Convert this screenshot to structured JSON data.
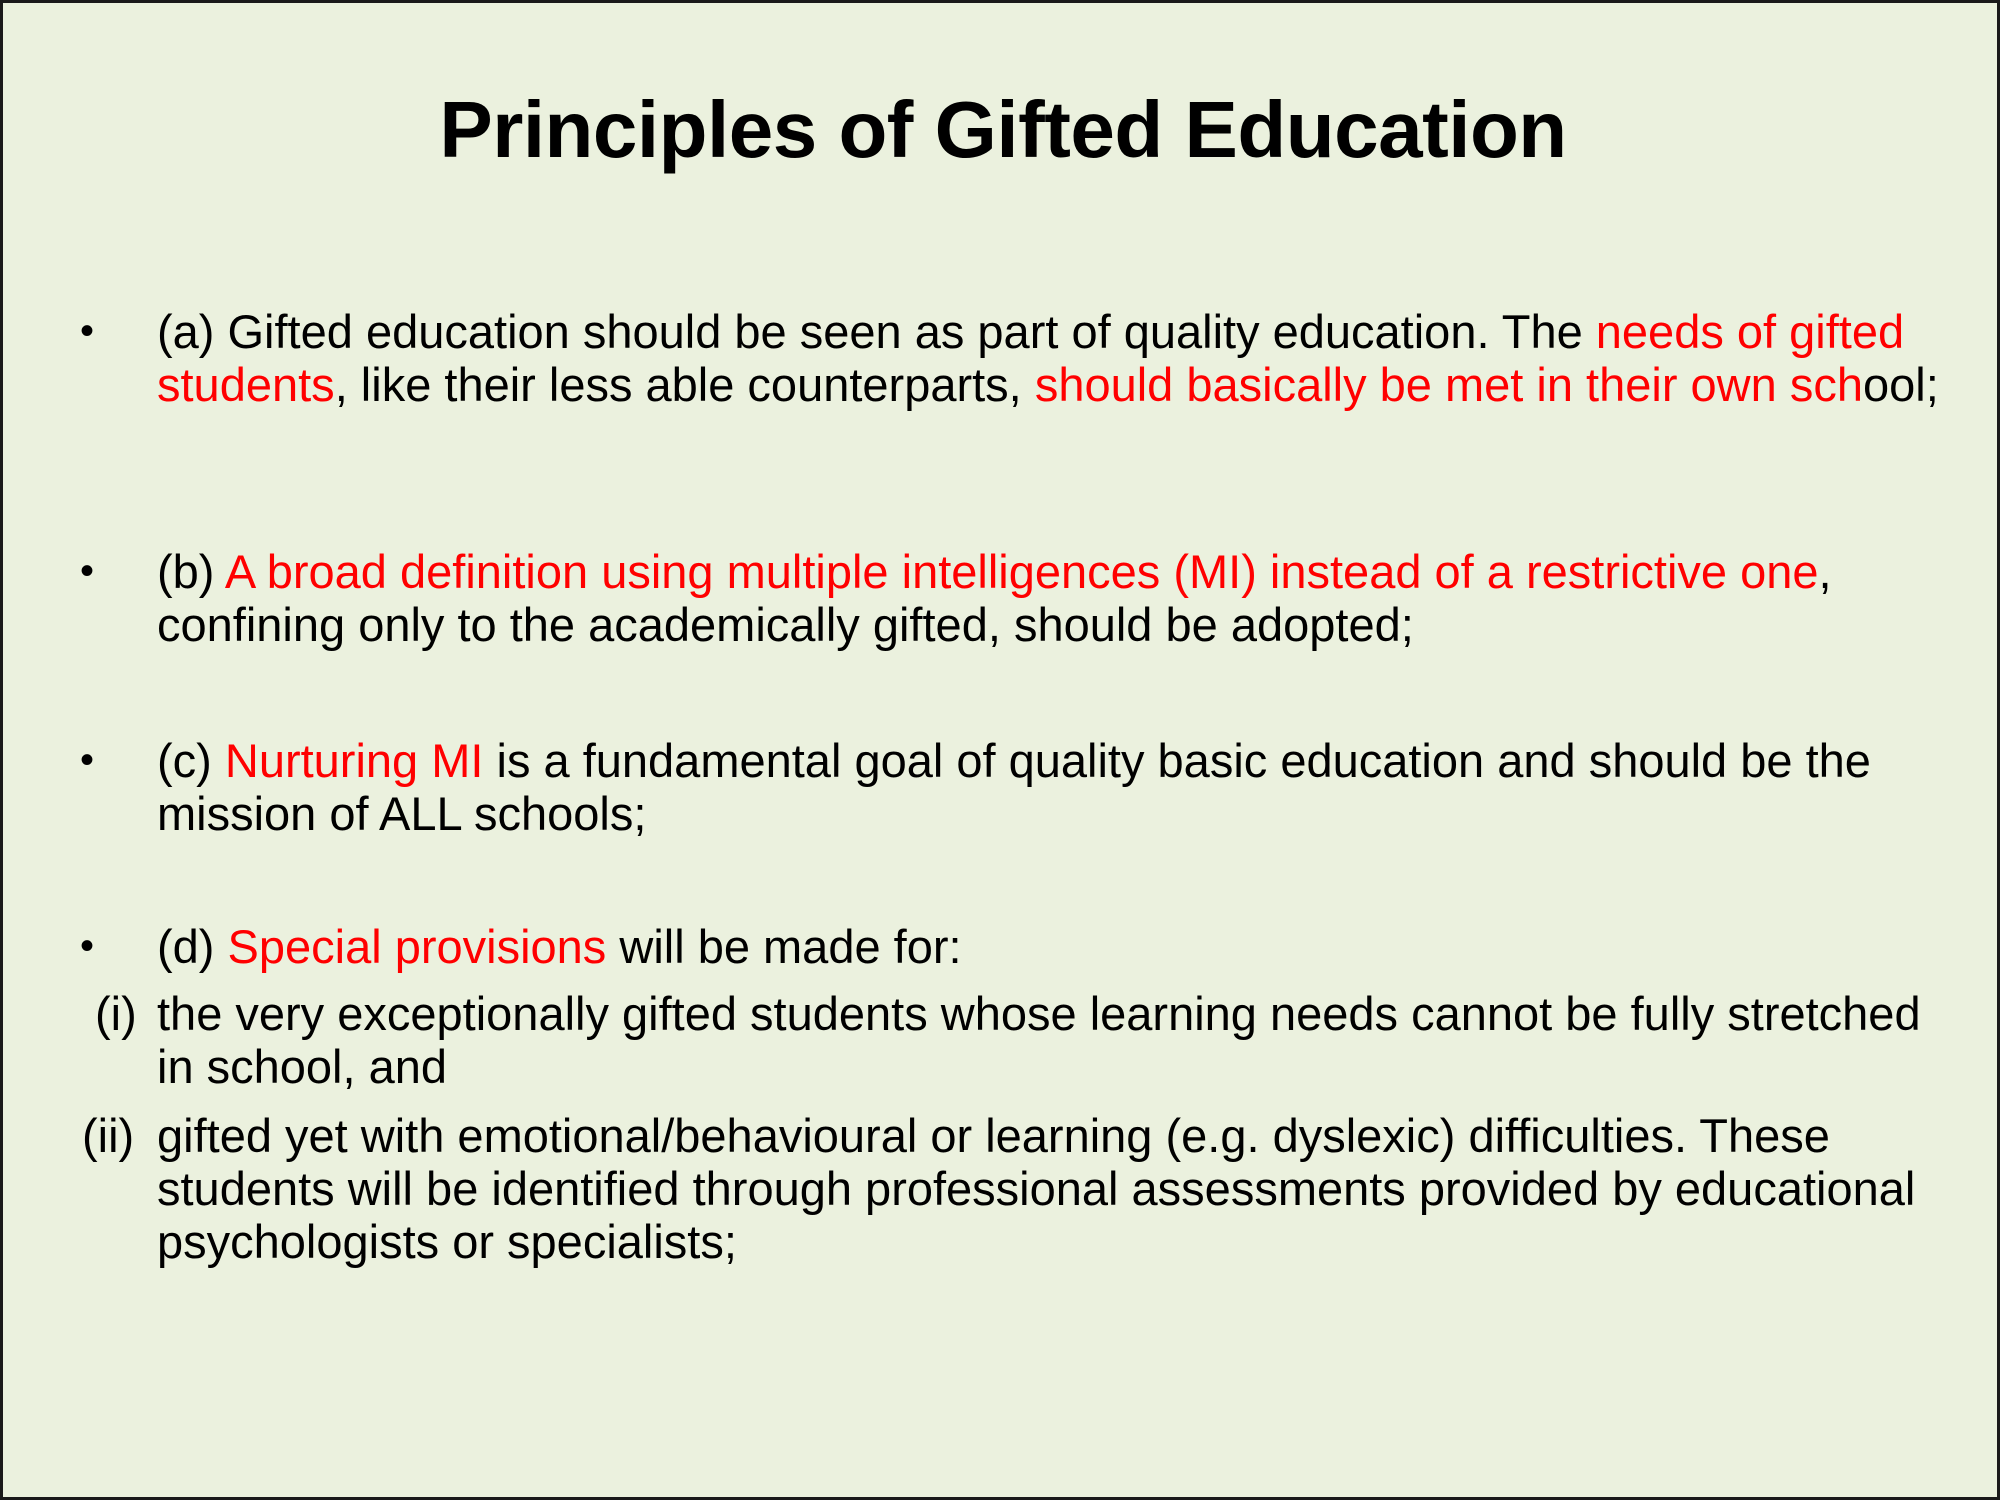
{
  "slide": {
    "title": "Principles of Gifted Education",
    "bullet_symbol": "•",
    "accent_color": "#ff0000",
    "background_color": "#ebf1de"
  },
  "bullets": [
    {
      "segments": [
        {
          "text": "(a) Gifted education should be seen as part of quality education. The ",
          "highlight": false
        },
        {
          "text": "needs of gifted students",
          "highlight": true
        },
        {
          "text": ", like their less able counterparts, ",
          "highlight": false
        },
        {
          "text": "should basically be met in their own sch",
          "highlight": true
        },
        {
          "text": "ool;",
          "highlight": false
        }
      ]
    },
    {
      "segments": [
        {
          "text": "(b) ",
          "highlight": false
        },
        {
          "text": "A broad definition using multiple intelligences (MI) instead of a restrictive one",
          "highlight": true
        },
        {
          "text": ", confining only to the academically gifted, should be adopted;",
          "highlight": false
        }
      ]
    },
    {
      "segments": [
        {
          "text": "(c) ",
          "highlight": false
        },
        {
          "text": "Nurturing MI",
          "highlight": true
        },
        {
          "text": " is a fundamental goal of quality basic education and should be the mission of ALL schools;",
          "highlight": false
        }
      ]
    },
    {
      "segments": [
        {
          "text": "(d) ",
          "highlight": false
        },
        {
          "text": "Special provisions",
          "highlight": true
        },
        {
          "text": " will be made for:",
          "highlight": false
        }
      ]
    }
  ],
  "sub_items": [
    {
      "number": "(i)",
      "text": "the very exceptionally gifted students whose learning needs cannot be fully stretched in school, and"
    },
    {
      "number": "(ii)",
      "text": "gifted yet with emotional/behavioural or learning (e.g. dyslexic) difficulties. These students will be identified through professional assessments provided by educational psychologists or specialists;"
    }
  ]
}
